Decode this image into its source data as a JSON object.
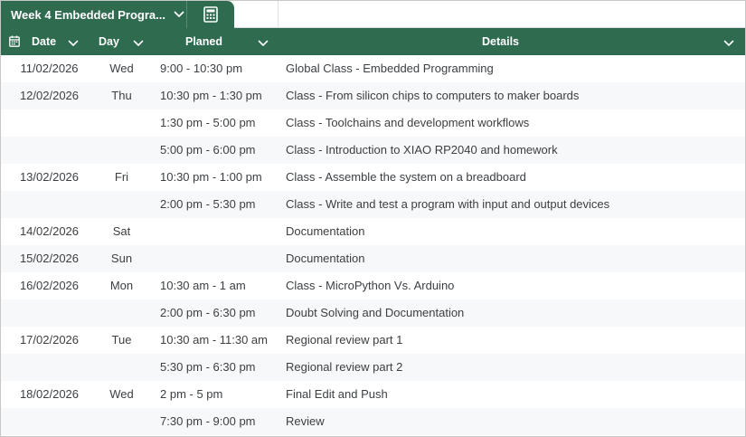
{
  "tab": {
    "title": "Week 4 Embedded Progra..."
  },
  "icons": {
    "tab_chevron": "chevron-down-icon",
    "calculator": "calculator-icon",
    "date_column": "calendar-icon"
  },
  "colors": {
    "header_bg": "#2e6b4f",
    "header_text": "#ffffff",
    "row_alt": "#f6f8f9",
    "text": "#3c4043"
  },
  "columns": {
    "date": "Date",
    "day": "Day",
    "planed": "Planed",
    "details": "Details"
  },
  "rows": [
    {
      "date": "11/02/2026",
      "day": "Wed",
      "planed": "9:00 - 10:30 pm",
      "details": "Global Class - Embedded Programming"
    },
    {
      "date": "12/02/2026",
      "day": "Thu",
      "planed": "10:30 pm - 1:30 pm",
      "details": "Class - From silicon chips to computers to maker boards"
    },
    {
      "date": "",
      "day": "",
      "planed": "1:30 pm - 5:00 pm",
      "details": "Class - Toolchains and development workflows"
    },
    {
      "date": "",
      "day": "",
      "planed": "5:00 pm - 6:00 pm",
      "details": "Class - Introduction to XIAO RP2040 and homework"
    },
    {
      "date": "13/02/2026",
      "day": "Fri",
      "planed": "10:30 pm - 1:00 pm",
      "details": "Class - Assemble the system on a breadboard"
    },
    {
      "date": "",
      "day": "",
      "planed": "2:00 pm - 5:30 pm",
      "details": "Class - Write and test a program with input and output devices"
    },
    {
      "date": "14/02/2026",
      "day": "Sat",
      "planed": "",
      "details": "Documentation"
    },
    {
      "date": "15/02/2026",
      "day": "Sun",
      "planed": "",
      "details": "Documentation"
    },
    {
      "date": "16/02/2026",
      "day": "Mon",
      "planed": "10:30 am - 1 am",
      "details": "Class - MicroPython Vs. Arduino"
    },
    {
      "date": "",
      "day": "",
      "planed": "2:00 pm - 6:30 pm",
      "details": "Doubt Solving and Documentation"
    },
    {
      "date": "17/02/2026",
      "day": "Tue",
      "planed": "10:30 am - 11:30 am",
      "details": "Regional review part 1"
    },
    {
      "date": "",
      "day": "",
      "planed": "5:30 pm - 6:30 pm",
      "details": "Regional review part 2"
    },
    {
      "date": "18/02/2026",
      "day": "Wed",
      "planed": "2 pm - 5 pm",
      "details": "Final Edit and Push"
    },
    {
      "date": "",
      "day": "",
      "planed": "7:30 pm - 9:00 pm",
      "details": "Review"
    }
  ]
}
